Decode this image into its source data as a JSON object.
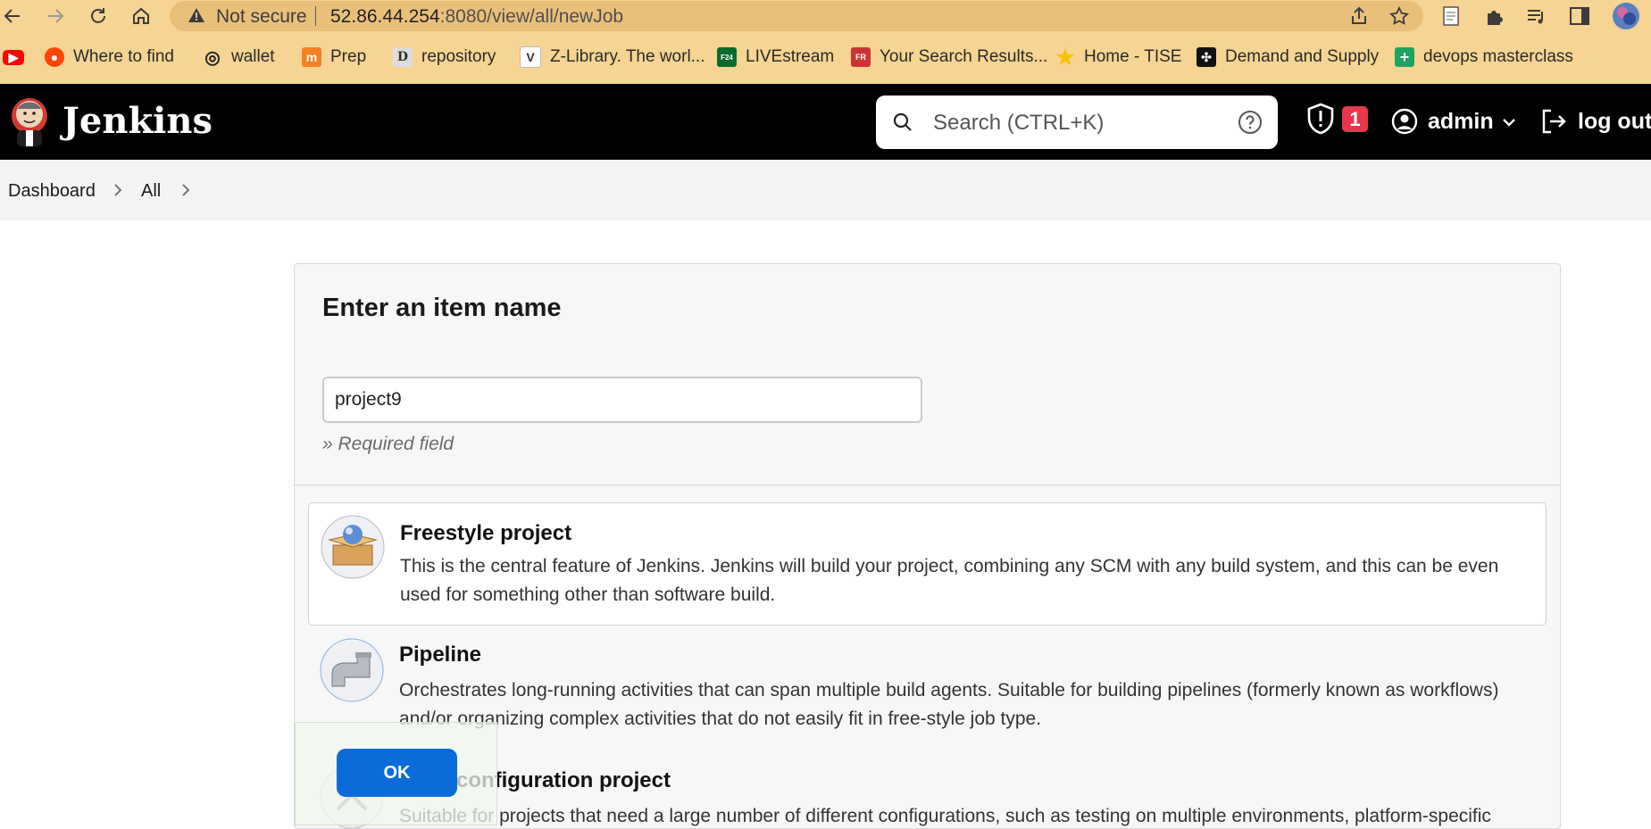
{
  "browser": {
    "security_label": "Not secure",
    "url_host": "52.86.44.254",
    "url_rest": ":8080/view/all/newJob",
    "bookmarks": [
      {
        "label": ""
      },
      {
        "label": "Where to find"
      },
      {
        "label": "wallet"
      },
      {
        "label": "Prep"
      },
      {
        "label": "repository"
      },
      {
        "label": "Z-Library. The worl..."
      },
      {
        "label": "LIVEstream"
      },
      {
        "label": "Your Search Results..."
      },
      {
        "label": "Home - TISE"
      },
      {
        "label": "Demand and Supply"
      },
      {
        "label": "devops masterclass"
      }
    ]
  },
  "header": {
    "title": "Jenkins",
    "search_placeholder": "Search (CTRL+K)",
    "security_count": "1",
    "user": "admin",
    "logout": "log out"
  },
  "breadcrumb": {
    "items": [
      "Dashboard",
      "All"
    ]
  },
  "form": {
    "heading": "Enter an item name",
    "item_name_value": "project9",
    "required_note": "» Required field",
    "ok_label": "OK"
  },
  "item_types": [
    {
      "title": "Freestyle project",
      "description": "This is the central feature of Jenkins. Jenkins will build your project, combining any SCM with any build system, and this can be even used for something other than software build."
    },
    {
      "title": "Pipeline",
      "description": "Orchestrates long-running activities that can span multiple build agents. Suitable for building pipelines (formerly known as workflows) and/or organizing complex activities that do not easily fit in free-style job type."
    },
    {
      "title": "Multi-configuration project",
      "description": "Suitable for projects that need a large number of different configurations, such as testing on multiple environments, platform-specific builds, etc."
    }
  ],
  "colors": {
    "browser_chrome": "#f6d493",
    "header_bg": "#000000",
    "ok_button": "#0b6cd9",
    "security_badge": "#e5384a"
  }
}
